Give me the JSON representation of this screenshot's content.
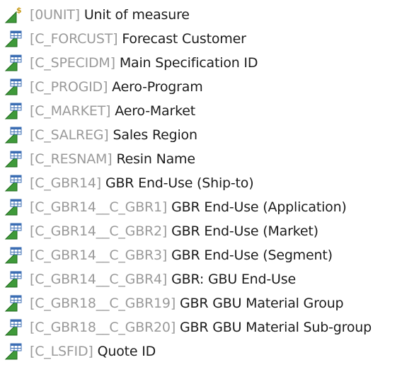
{
  "tree": {
    "items": [
      {
        "code": "[0UNIT]",
        "label": "Unit of measure",
        "icon": "unit-characteristic-icon"
      },
      {
        "code": "[C_FORCUST]",
        "label": "Forecast Customer",
        "icon": "characteristic-icon"
      },
      {
        "code": "[C_SPECIDM]",
        "label": "Main Specification ID",
        "icon": "characteristic-icon"
      },
      {
        "code": "[C_PROGID]",
        "label": "Aero-Program",
        "icon": "characteristic-icon"
      },
      {
        "code": "[C_MARKET]",
        "label": "Aero-Market",
        "icon": "characteristic-icon"
      },
      {
        "code": "[C_SALREG]",
        "label": "Sales Region",
        "icon": "characteristic-icon"
      },
      {
        "code": "[C_RESNAM]",
        "label": "Resin Name",
        "icon": "characteristic-icon"
      },
      {
        "code": "[C_GBR14]",
        "label": "GBR End-Use (Ship-to)",
        "icon": "characteristic-icon"
      },
      {
        "code": "[C_GBR14__C_GBR1]",
        "label": "GBR End-Use (Application)",
        "icon": "characteristic-icon"
      },
      {
        "code": "[C_GBR14__C_GBR2]",
        "label": "GBR End-Use (Market)",
        "icon": "characteristic-icon"
      },
      {
        "code": "[C_GBR14__C_GBR3]",
        "label": "GBR End-Use (Segment)",
        "icon": "characteristic-icon"
      },
      {
        "code": "[C_GBR14__C_GBR4]",
        "label": "GBR: GBU End-Use",
        "icon": "characteristic-icon"
      },
      {
        "code": "[C_GBR18__C_GBR19]",
        "label": "GBR GBU Material Group",
        "icon": "characteristic-icon"
      },
      {
        "code": "[C_GBR18__C_GBR20]",
        "label": "GBR GBU Material Sub-group",
        "icon": "characteristic-icon"
      },
      {
        "code": "[C_LSFID]",
        "label": "Quote ID",
        "icon": "characteristic-icon"
      }
    ]
  },
  "colors": {
    "code_text": "#9a9a9a",
    "label_text": "#1c1c1c",
    "triangle_green": "#3f9a3a",
    "triangle_dark": "#1f6a1c",
    "flag_blue": "#3b6db3",
    "dollar_gold": "#c79a16"
  }
}
